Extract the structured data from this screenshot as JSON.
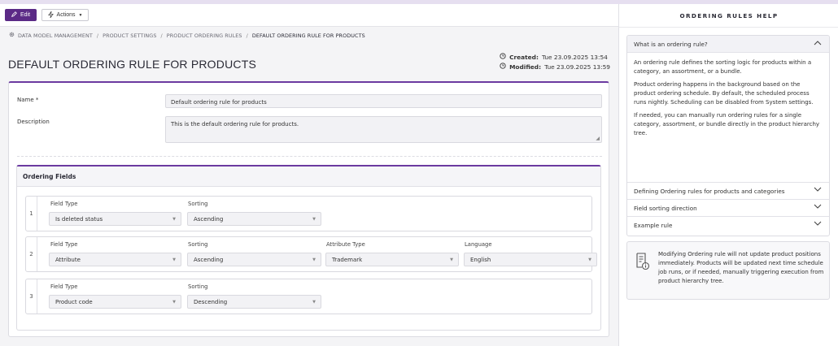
{
  "toolbar": {
    "edit_label": "Edit",
    "actions_label": "Actions"
  },
  "breadcrumb": [
    "DATA MODEL MANAGEMENT",
    "PRODUCT SETTINGS",
    "PRODUCT ORDERING RULES",
    "DEFAULT ORDERING RULE FOR PRODUCTS"
  ],
  "page": {
    "title": "DEFAULT ORDERING RULE FOR PRODUCTS",
    "created_label": "Created:",
    "created_value": "Tue 23.09.2025 13:54",
    "modified_label": "Modified:",
    "modified_value": "Tue 23.09.2025 13:59"
  },
  "form": {
    "name_label": "Name *",
    "name_value": "Default ordering rule for products",
    "description_label": "Description",
    "description_value": "This is the default ordering rule for products."
  },
  "ordering": {
    "title": "Ordering Fields",
    "rows": [
      {
        "num": "1",
        "field_type_label": "Field Type",
        "field_type": "Is deleted status",
        "sorting_label": "Sorting",
        "sorting": "Ascending"
      },
      {
        "num": "2",
        "field_type_label": "Field Type",
        "field_type": "Attribute",
        "sorting_label": "Sorting",
        "sorting": "Ascending",
        "attribute_type_label": "Attribute Type",
        "attribute_type": "Trademark",
        "language_label": "Language",
        "language": "English"
      },
      {
        "num": "3",
        "field_type_label": "Field Type",
        "field_type": "Product code",
        "sorting_label": "Sorting",
        "sorting": "Descending"
      }
    ]
  },
  "help": {
    "title": "ORDERING RULES HELP",
    "sections": [
      {
        "title": "What is an ordering rule?",
        "open": true
      },
      {
        "title": "Defining Ordering rules for products and categories",
        "open": false
      },
      {
        "title": "Field sorting direction",
        "open": false
      },
      {
        "title": "Example rule",
        "open": false
      }
    ],
    "body": [
      "An ordering rule defines the sorting logic for products within a category, an assortment, or a bundle.",
      "Product ordering happens in the background based on the product ordering schedule. By default, the scheduled process runs nightly. Scheduling can be disabled from System settings.",
      "If needed, you can manually run ordering rules for a single category, assortment, or bundle directly in the product hierarchy tree."
    ],
    "note": "Modifying Ordering rule will not update product positions immediately. Products will be updated next time schedule job runs, or if needed, manually triggering execution from product hierarchy tree."
  },
  "colors": {
    "accent": "#5b2a86",
    "border_accent": "#6b3aa0"
  },
  "icons": [
    "pencil-icon",
    "lightning-icon",
    "caret-down-icon",
    "gear-icon",
    "clock-icon",
    "chevron-up-icon",
    "chevron-down-icon",
    "info-document-icon"
  ]
}
